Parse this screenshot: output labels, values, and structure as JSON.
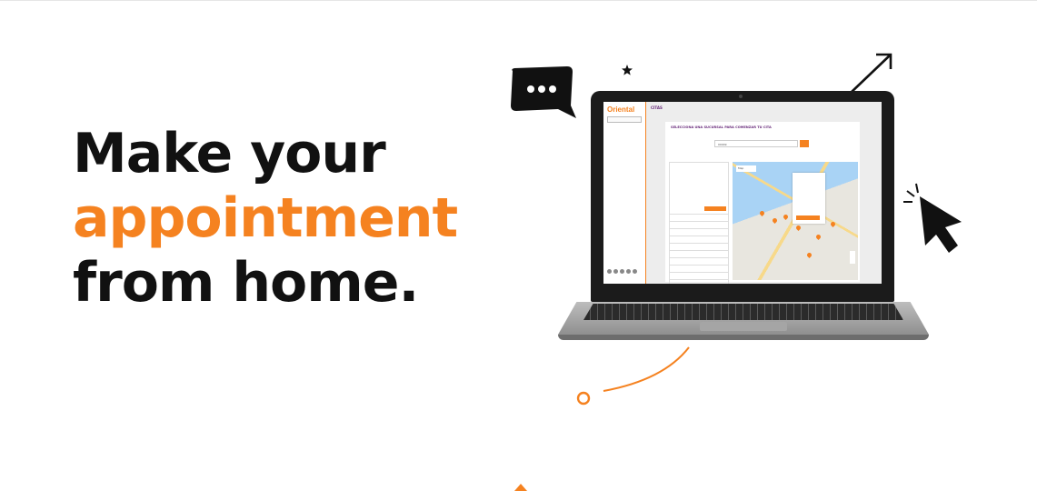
{
  "headline": {
    "line1": "Make your",
    "line2": "appointment",
    "line3": "from home."
  },
  "colors": {
    "accent": "#f58220",
    "text": "#111111",
    "brand_purple": "#6a2d7c"
  },
  "icons": [
    "chat-bubble-icon",
    "star-icon",
    "arrow-up-right-icon",
    "cursor-pointer-icon"
  ],
  "laptop_screen": {
    "logo": "Oriental",
    "page_header": "CITAS",
    "card_title": "SELECCIONA UNA SUCURSAL PARA COMENZAR TU CITA",
    "search_value": "00949",
    "map_type": "Map"
  }
}
